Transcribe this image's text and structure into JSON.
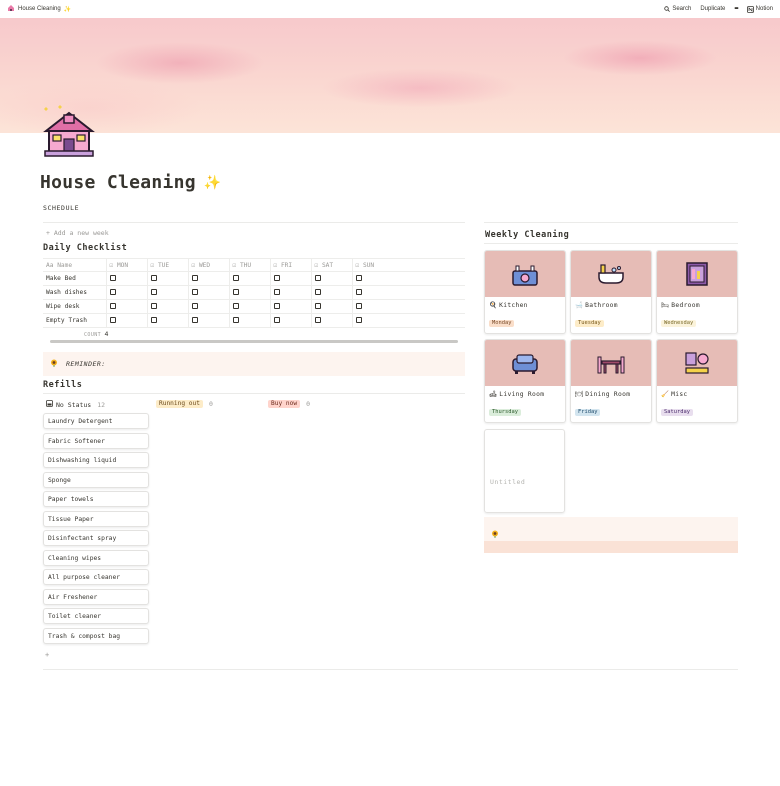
{
  "topbar": {
    "page_title": "House Cleaning",
    "title_emoji": "✨",
    "search": "Search",
    "duplicate": "Duplicate",
    "more": "•••",
    "notion": "Notion"
  },
  "page": {
    "title": "House Cleaning",
    "title_emoji": "✨",
    "section_label": "SCHEDULE"
  },
  "daily": {
    "add_new": "Add a new week",
    "heading": "Daily Checklist",
    "columns": [
      "Name",
      "MON",
      "TUE",
      "WED",
      "THU",
      "FRI",
      "SAT",
      "SUN"
    ],
    "rows": [
      {
        "name": "Make Bed",
        "checks": [
          false,
          false,
          false,
          false,
          false,
          false,
          false
        ]
      },
      {
        "name": "Wash dishes",
        "checks": [
          false,
          false,
          false,
          false,
          false,
          false,
          false
        ]
      },
      {
        "name": "Wipe desk",
        "checks": [
          false,
          false,
          false,
          false,
          false,
          false,
          false
        ]
      },
      {
        "name": "Empty Trash",
        "checks": [
          false,
          false,
          false,
          false,
          false,
          false,
          false
        ]
      }
    ],
    "count_label": "COUNT",
    "count_value": "4"
  },
  "reminder": {
    "label": "REMINDER:"
  },
  "refills": {
    "heading": "Refills",
    "groups": [
      {
        "label": "No Status",
        "count": "12"
      },
      {
        "label": "Running out",
        "count": "0"
      },
      {
        "label": "Buy now",
        "count": "0"
      }
    ],
    "items": [
      "Laundry Detergent",
      "Fabric Softener",
      "Dishwashing liquid",
      "Sponge",
      "Paper towels",
      "Tissue Paper",
      "Disinfectant spray",
      "Cleaning wipes",
      "All purpose cleaner",
      "Air Freshener",
      "Toilet cleaner",
      "Trash & compost bag"
    ],
    "add_plus": "+"
  },
  "weekly": {
    "heading": "Weekly Cleaning",
    "cards": [
      {
        "name": "Kitchen",
        "day": "Monday"
      },
      {
        "name": "Bathroom",
        "day": "Tuesday"
      },
      {
        "name": "Bedroom",
        "day": "Wednesday"
      },
      {
        "name": "Living Room",
        "day": "Thursday"
      },
      {
        "name": "Dining Room",
        "day": "Friday"
      },
      {
        "name": "Misc",
        "day": "Saturday"
      }
    ],
    "untitled": "Untitled"
  },
  "colors": {
    "monday": "#fadec9",
    "tuesday": "#fdecc8",
    "wednesday": "#fbf3db",
    "thursday": "#dbeddb",
    "friday": "#d3e5ef",
    "saturday": "#e8deee",
    "running_out": "#fdecc8",
    "buy_now": "#ffe2dd",
    "card_image_bg": "#e6bcb6"
  }
}
